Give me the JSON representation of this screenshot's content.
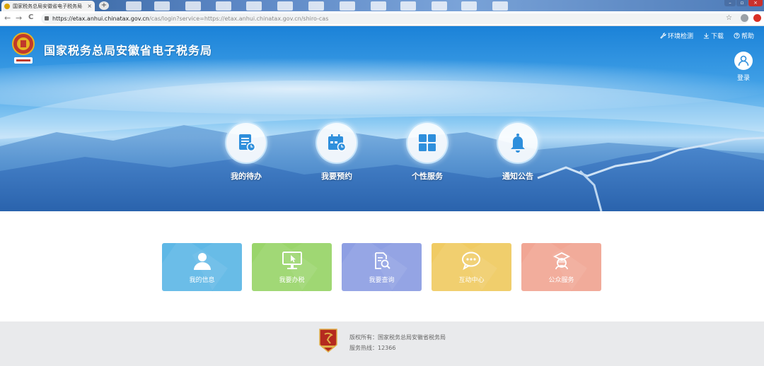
{
  "browser": {
    "tab_title": "国家税务总局安徽省电子税务局",
    "tab_close": "×",
    "new_tab": "+",
    "url_host": "https://etax.anhui.chinatax.gov.cn",
    "url_path": "/cas/login?service=https://etax.anhui.chinatax.gov.cn/shiro-cas",
    "back": "←",
    "forward": "→",
    "reload": "C",
    "star": "☆",
    "win_min": "–",
    "win_max": "▫",
    "win_close": "×"
  },
  "header": {
    "title": "国家税务总局安徽省电子税务局",
    "links": [
      {
        "label": "环境检测",
        "icon": "wrench-icon"
      },
      {
        "label": "下载",
        "icon": "download-icon"
      },
      {
        "label": "帮助",
        "icon": "help-icon"
      }
    ],
    "login_label": "登录"
  },
  "features": [
    {
      "label": "我的待办",
      "icon": "todo-icon"
    },
    {
      "label": "我要预约",
      "icon": "calendar-icon"
    },
    {
      "label": "个性服务",
      "icon": "grid-icon"
    },
    {
      "label": "通知公告",
      "icon": "bell-icon"
    }
  ],
  "cards": [
    {
      "label": "我的信息",
      "icon": "user-icon",
      "color": "#5fb8e6"
    },
    {
      "label": "我要办税",
      "icon": "monitor-icon",
      "color": "#9ad56b"
    },
    {
      "label": "我要查询",
      "icon": "search-doc-icon",
      "color": "#8e9fe3"
    },
    {
      "label": "互动中心",
      "icon": "chat-icon",
      "color": "#f0cb63"
    },
    {
      "label": "公众服务",
      "icon": "service-icon",
      "color": "#f1a694"
    }
  ],
  "footer": {
    "copyright": "版权所有：国家税务总局安徽省税务局",
    "hotline": "服务热线：12366"
  },
  "colors": {
    "brand_blue": "#1b82d8",
    "footer_bg": "#e9eaec",
    "icon_blue": "#2e8fdc"
  }
}
